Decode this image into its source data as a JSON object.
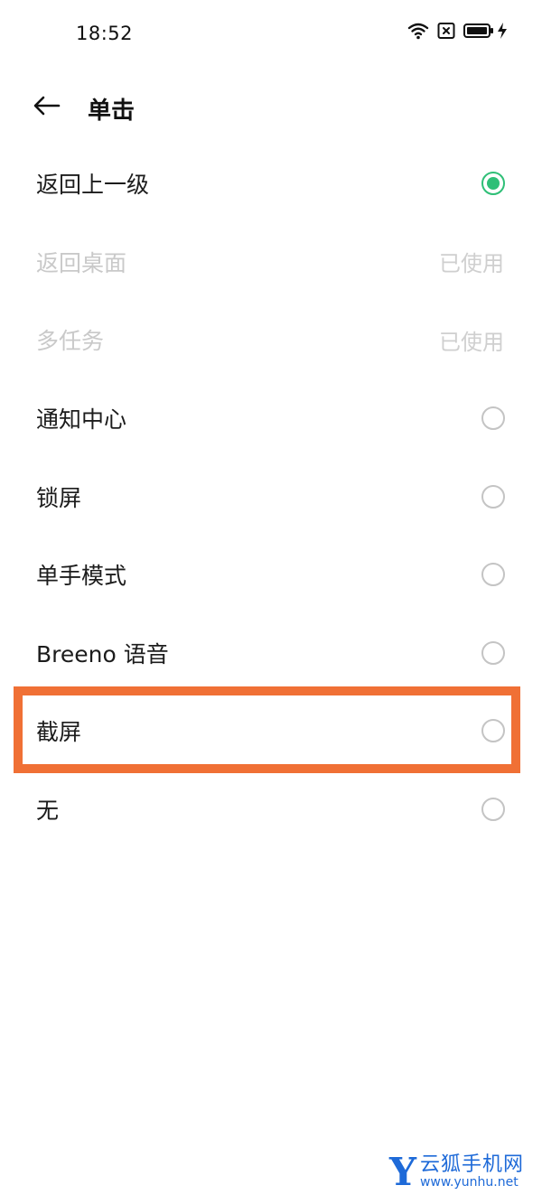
{
  "status_bar": {
    "time": "18:52",
    "icons": [
      "wifi-icon",
      "sim-x-icon",
      "battery-icon",
      "charging-bolt-icon"
    ]
  },
  "header": {
    "back_icon": "arrow-left-icon",
    "title": "单击"
  },
  "options": [
    {
      "label": "返回上一级",
      "state": "selected"
    },
    {
      "label": "返回桌面",
      "state": "disabled",
      "status": "已使用"
    },
    {
      "label": "多任务",
      "state": "disabled",
      "status": "已使用"
    },
    {
      "label": "通知中心",
      "state": "unselected"
    },
    {
      "label": "锁屏",
      "state": "unselected"
    },
    {
      "label": "单手模式",
      "state": "unselected"
    },
    {
      "label": "Breeno 语音",
      "state": "unselected"
    },
    {
      "label": "截屏",
      "state": "unselected",
      "highlighted": true
    },
    {
      "label": "无",
      "state": "unselected"
    }
  ],
  "colors": {
    "accent": "#2fbf77",
    "highlight": "#f07035",
    "disabled_text": "#c9c9c9",
    "watermark": "#1e6ad8"
  },
  "watermark": {
    "logo": "Y",
    "brand": "云狐手机网",
    "url": "www.yunhu.net"
  }
}
